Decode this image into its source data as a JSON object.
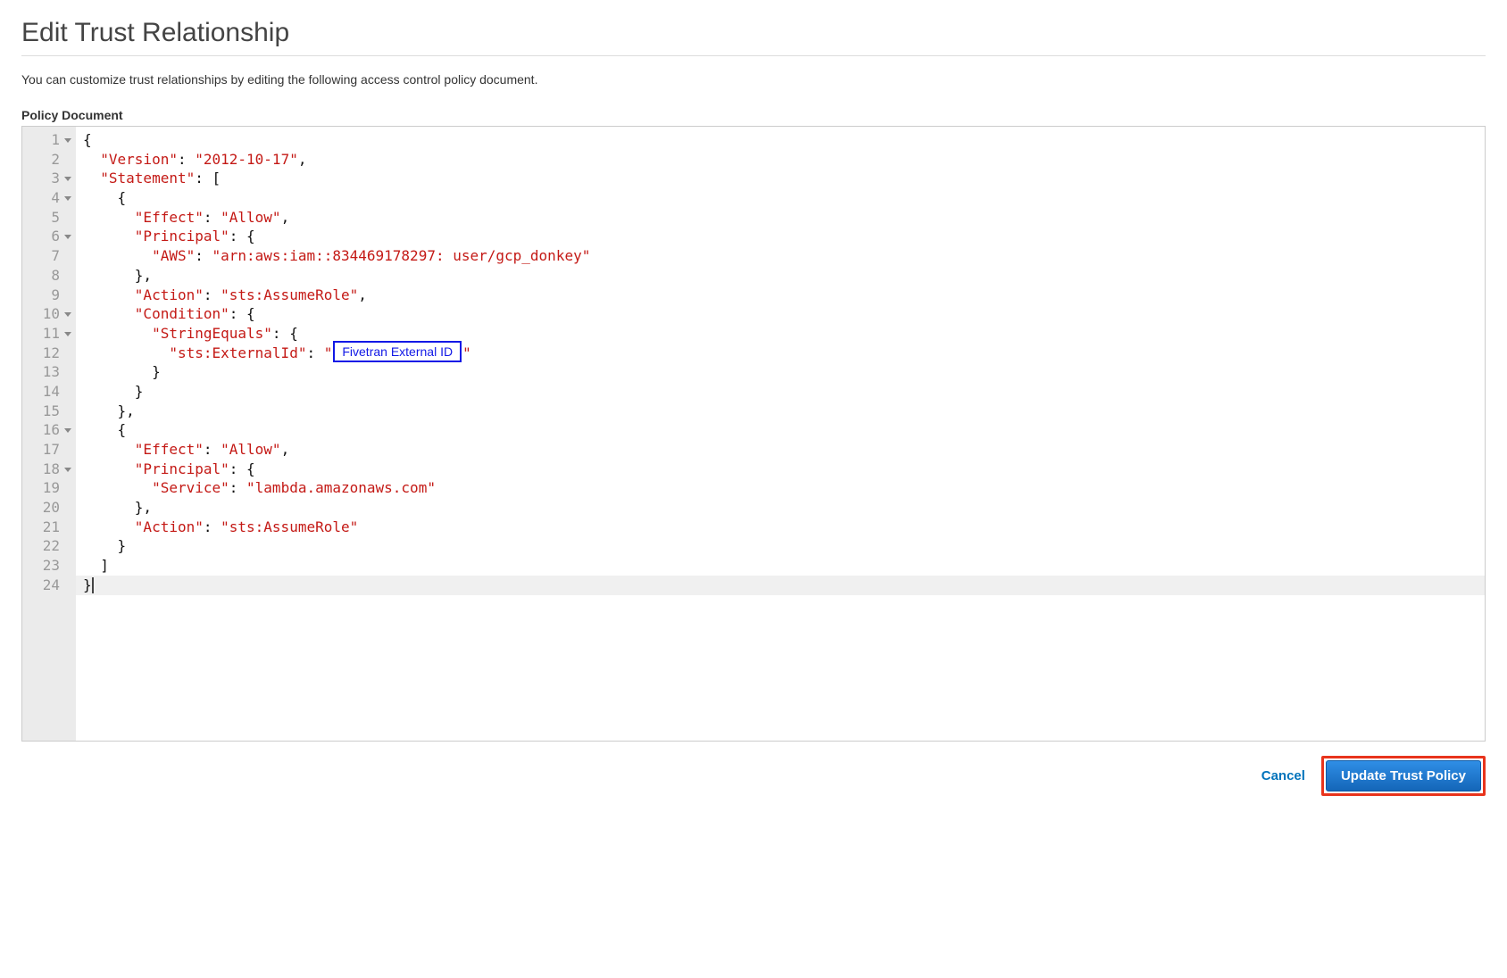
{
  "page": {
    "title": "Edit Trust Relationship",
    "intro": "You can customize trust relationships by editing the following access control policy document.",
    "section_label": "Policy Document"
  },
  "editor": {
    "callout": "Fivetran External ID",
    "lines": [
      {
        "n": 1,
        "fold": true,
        "indent": "",
        "segs": [
          {
            "t": "{",
            "c": "p"
          }
        ]
      },
      {
        "n": 2,
        "fold": false,
        "indent": "  ",
        "segs": [
          {
            "t": "\"Version\"",
            "c": "k"
          },
          {
            "t": ": ",
            "c": "p"
          },
          {
            "t": "\"2012-10-17\"",
            "c": "k"
          },
          {
            "t": ",",
            "c": "p"
          }
        ]
      },
      {
        "n": 3,
        "fold": true,
        "indent": "  ",
        "segs": [
          {
            "t": "\"Statement\"",
            "c": "k"
          },
          {
            "t": ": [",
            "c": "p"
          }
        ]
      },
      {
        "n": 4,
        "fold": true,
        "indent": "    ",
        "segs": [
          {
            "t": "{",
            "c": "p"
          }
        ]
      },
      {
        "n": 5,
        "fold": false,
        "indent": "      ",
        "segs": [
          {
            "t": "\"Effect\"",
            "c": "k"
          },
          {
            "t": ": ",
            "c": "p"
          },
          {
            "t": "\"Allow\"",
            "c": "k"
          },
          {
            "t": ",",
            "c": "p"
          }
        ]
      },
      {
        "n": 6,
        "fold": true,
        "indent": "      ",
        "segs": [
          {
            "t": "\"Principal\"",
            "c": "k"
          },
          {
            "t": ": {",
            "c": "p"
          }
        ]
      },
      {
        "n": 7,
        "fold": false,
        "indent": "        ",
        "segs": [
          {
            "t": "\"AWS\"",
            "c": "k"
          },
          {
            "t": ": ",
            "c": "p"
          },
          {
            "t": "\"arn:aws:iam::834469178297: user/gcp_donkey\"",
            "c": "k"
          }
        ]
      },
      {
        "n": 8,
        "fold": false,
        "indent": "      ",
        "segs": [
          {
            "t": "},",
            "c": "p"
          }
        ]
      },
      {
        "n": 9,
        "fold": false,
        "indent": "      ",
        "segs": [
          {
            "t": "\"Action\"",
            "c": "k"
          },
          {
            "t": ": ",
            "c": "p"
          },
          {
            "t": "\"sts:AssumeRole\"",
            "c": "k"
          },
          {
            "t": ",",
            "c": "p"
          }
        ]
      },
      {
        "n": 10,
        "fold": true,
        "indent": "      ",
        "segs": [
          {
            "t": "\"Condition\"",
            "c": "k"
          },
          {
            "t": ": {",
            "c": "p"
          }
        ]
      },
      {
        "n": 11,
        "fold": true,
        "indent": "        ",
        "segs": [
          {
            "t": "\"StringEquals\"",
            "c": "k"
          },
          {
            "t": ": {",
            "c": "p"
          }
        ]
      },
      {
        "n": 12,
        "fold": false,
        "indent": "          ",
        "segs": [
          {
            "t": "\"sts:ExternalId\"",
            "c": "k"
          },
          {
            "t": ": ",
            "c": "p"
          },
          {
            "t": "\"",
            "c": "k"
          },
          {
            "t": "CALLOUT",
            "c": "callout"
          },
          {
            "t": "\"",
            "c": "k"
          }
        ]
      },
      {
        "n": 13,
        "fold": false,
        "indent": "        ",
        "segs": [
          {
            "t": "}",
            "c": "p"
          }
        ]
      },
      {
        "n": 14,
        "fold": false,
        "indent": "      ",
        "segs": [
          {
            "t": "}",
            "c": "p"
          }
        ]
      },
      {
        "n": 15,
        "fold": false,
        "indent": "    ",
        "segs": [
          {
            "t": "},",
            "c": "p"
          }
        ]
      },
      {
        "n": 16,
        "fold": true,
        "indent": "    ",
        "segs": [
          {
            "t": "{",
            "c": "p"
          }
        ]
      },
      {
        "n": 17,
        "fold": false,
        "indent": "      ",
        "segs": [
          {
            "t": "\"Effect\"",
            "c": "k"
          },
          {
            "t": ": ",
            "c": "p"
          },
          {
            "t": "\"Allow\"",
            "c": "k"
          },
          {
            "t": ",",
            "c": "p"
          }
        ]
      },
      {
        "n": 18,
        "fold": true,
        "indent": "      ",
        "segs": [
          {
            "t": "\"Principal\"",
            "c": "k"
          },
          {
            "t": ": {",
            "c": "p"
          }
        ]
      },
      {
        "n": 19,
        "fold": false,
        "indent": "        ",
        "segs": [
          {
            "t": "\"Service\"",
            "c": "k"
          },
          {
            "t": ": ",
            "c": "p"
          },
          {
            "t": "\"lambda.amazonaws.com\"",
            "c": "k"
          }
        ]
      },
      {
        "n": 20,
        "fold": false,
        "indent": "      ",
        "segs": [
          {
            "t": "},",
            "c": "p"
          }
        ]
      },
      {
        "n": 21,
        "fold": false,
        "indent": "      ",
        "segs": [
          {
            "t": "\"Action\"",
            "c": "k"
          },
          {
            "t": ": ",
            "c": "p"
          },
          {
            "t": "\"sts:AssumeRole\"",
            "c": "k"
          }
        ]
      },
      {
        "n": 22,
        "fold": false,
        "indent": "    ",
        "segs": [
          {
            "t": "}",
            "c": "p"
          }
        ]
      },
      {
        "n": 23,
        "fold": false,
        "indent": "  ",
        "segs": [
          {
            "t": "]",
            "c": "p"
          }
        ]
      },
      {
        "n": 24,
        "fold": false,
        "indent": "",
        "segs": [
          {
            "t": "}",
            "c": "p"
          }
        ],
        "highlight": true,
        "cursor": true
      }
    ]
  },
  "footer": {
    "cancel": "Cancel",
    "update": "Update Trust Policy"
  }
}
